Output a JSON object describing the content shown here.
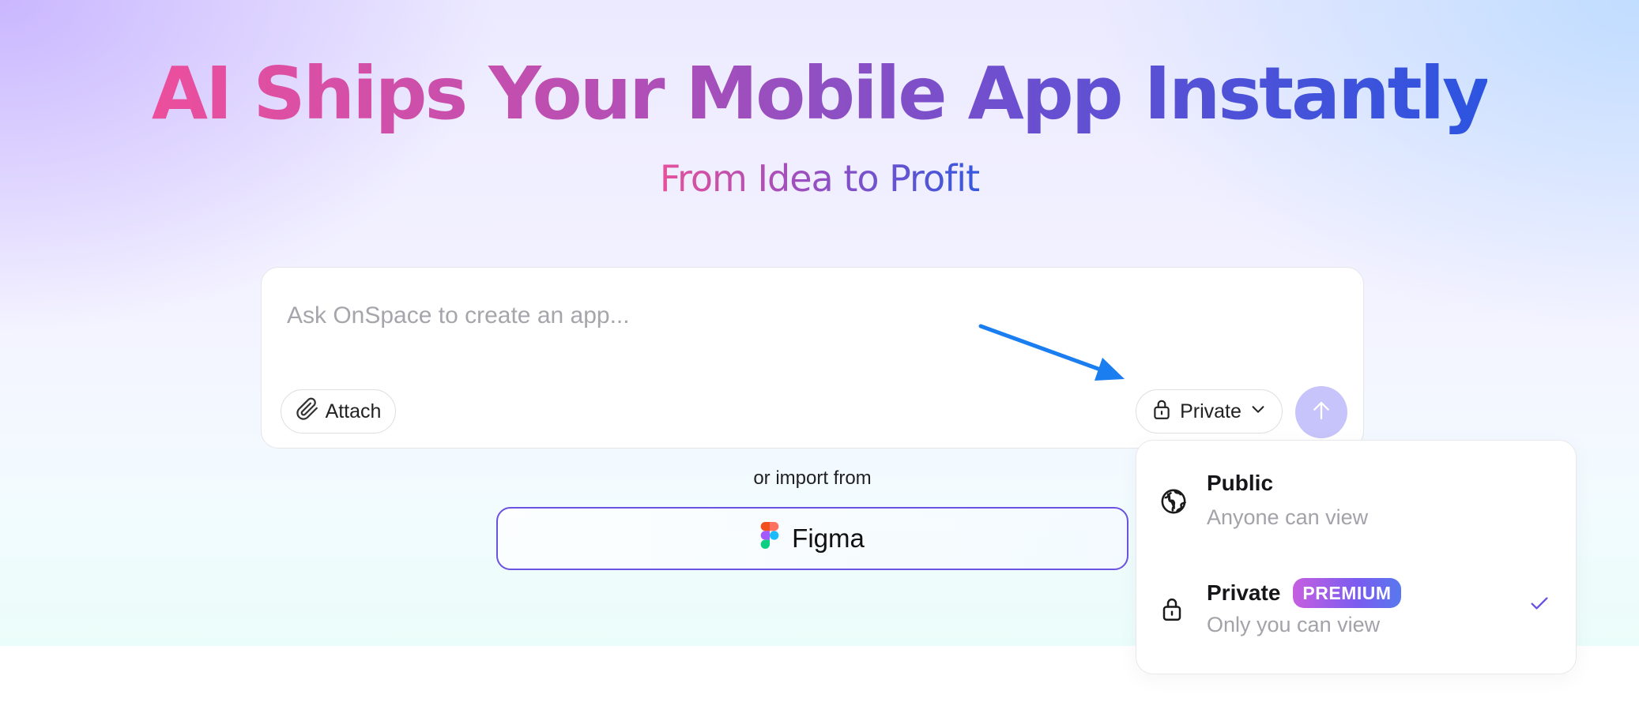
{
  "hero": {
    "headline": "AI Ships Your Mobile App Instantly",
    "subheadline": "From Idea to Profit"
  },
  "prompt": {
    "placeholder": "Ask OnSpace to create an app...",
    "value": "",
    "attach_label": "Attach",
    "privacy_label": "Private",
    "send_enabled": false
  },
  "import": {
    "label": "or import from",
    "figma_label": "Figma"
  },
  "privacy_menu": {
    "options": [
      {
        "title": "Public",
        "description": "Anyone can view",
        "icon": "globe-icon",
        "selected": false
      },
      {
        "title": "Private",
        "description": "Only you can view",
        "icon": "lock-icon",
        "badge": "PREMIUM",
        "selected": true
      }
    ]
  },
  "colors": {
    "accent": "#6a52e2",
    "send_button": "#c6c4fa",
    "annotation_arrow": "#1a7ef0",
    "headline_gradient": [
      "#ec4f9c",
      "#6b4fd0",
      "#2c54e0"
    ]
  }
}
